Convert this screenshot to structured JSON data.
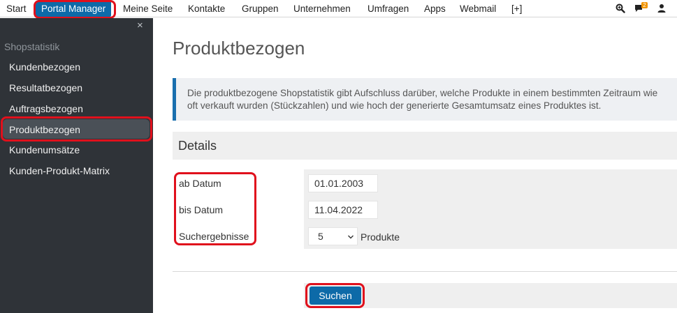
{
  "topnav": {
    "items": [
      "Start",
      "Portal Manager",
      "Meine Seite",
      "Kontakte",
      "Gruppen",
      "Unternehmen",
      "Umfragen",
      "Apps",
      "Webmail",
      "[+]"
    ],
    "active_index": 1,
    "notification_count": "2",
    "icons": [
      "search-zoom-icon",
      "chat-icon",
      "user-icon"
    ]
  },
  "sidebar": {
    "close_glyph": "×",
    "heading": "Shopstatistik",
    "items": [
      "Kundenbezogen",
      "Resultatbezogen",
      "Auftragsbezogen",
      "Produktbezogen",
      "Kundenumsätze",
      "Kunden-Produkt-Matrix"
    ],
    "active_index": 3
  },
  "main": {
    "title": "Produktbezogen",
    "info_line1": "Die produktbezogene Shopstatistik gibt Aufschluss darüber, welche Produkte in einem bestimmten Zeitraum wie",
    "info_line2": "oft verkauft wurden (Stückzahlen) und wie hoch der generierte Gesamtumsatz eines Produktes ist.",
    "details_heading": "Details",
    "form": {
      "from_label": "ab Datum",
      "from_value": "01.01.2003",
      "to_label": "bis Datum",
      "to_value": "11.04.2022",
      "results_label": "Suchergebnisse",
      "results_value": "5",
      "results_unit": "Produkte"
    },
    "search_button": "Suchen"
  },
  "colors": {
    "accent": "#0d6aa8",
    "sidebar_bg": "#2f3338",
    "highlight": "#e0101c",
    "badge": "#f29400"
  }
}
